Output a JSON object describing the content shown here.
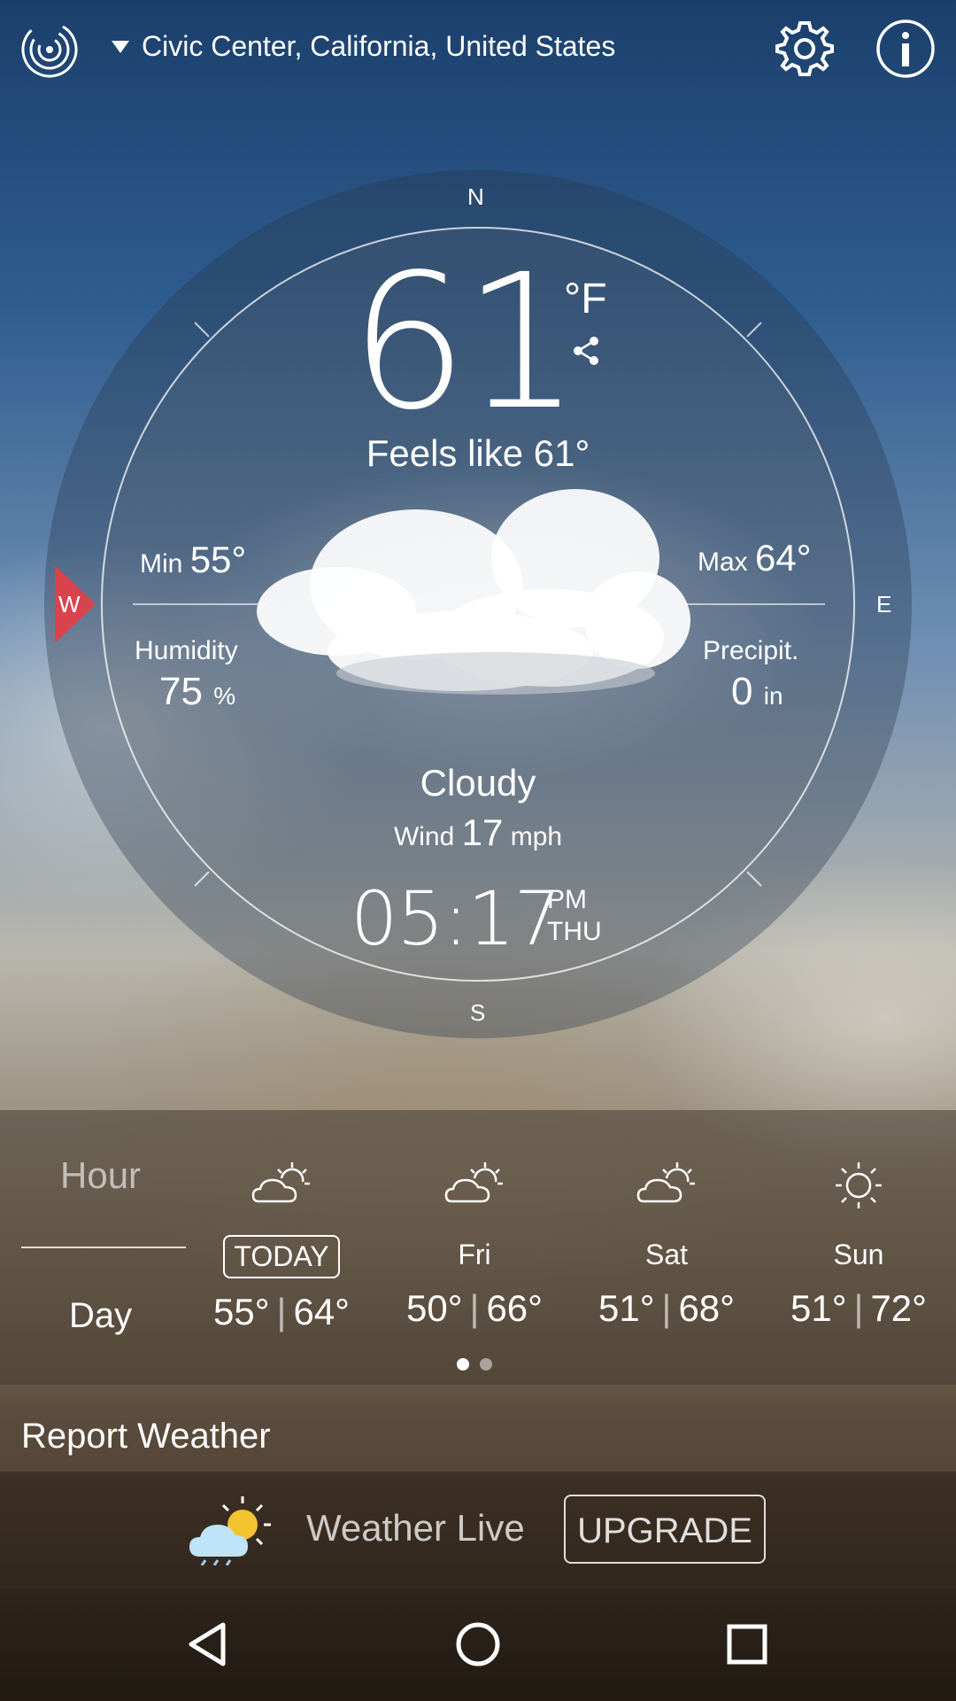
{
  "header": {
    "location": "Civic Center, California, United States",
    "icons": [
      "radar-logo-icon",
      "dropdown-triangle-icon",
      "gear-icon",
      "info-icon"
    ]
  },
  "current": {
    "temperature": "61",
    "unit": "°F",
    "feels_like": "Feels like 61°",
    "min_label": "Min",
    "min_value": "55°",
    "max_label": "Max",
    "max_value": "64°",
    "humidity_label": "Humidity",
    "humidity_value": "75",
    "humidity_unit": "%",
    "precip_label": "Precipit.",
    "precip_value": "0",
    "precip_unit": "in",
    "condition": "Cloudy",
    "wind_label": "Wind",
    "wind_value": "17",
    "wind_unit": "mph",
    "time": "05:17",
    "ampm": "PM",
    "weekday": "THU"
  },
  "compass": {
    "n": "N",
    "s": "S",
    "e": "E",
    "w": "W",
    "wind_direction": "W"
  },
  "forecast": {
    "tab_hour": "Hour",
    "tab_day": "Day",
    "active_tab": "Day",
    "days": [
      {
        "name": "TODAY",
        "low": "55°",
        "high": "64°",
        "icon": "partly-cloudy-icon"
      },
      {
        "name": "Fri",
        "low": "50°",
        "high": "66°",
        "icon": "partly-cloudy-icon"
      },
      {
        "name": "Sat",
        "low": "51°",
        "high": "68°",
        "icon": "partly-cloudy-icon"
      },
      {
        "name": "Sun",
        "low": "51°",
        "high": "72°",
        "icon": "sunny-icon"
      }
    ],
    "page": 1,
    "pages": 2
  },
  "report": {
    "label": "Report Weather"
  },
  "promo": {
    "app_name": "Weather Live",
    "button": "UPGRADE"
  },
  "colors": {
    "wind_marker": "#d9434e",
    "accent": "#ffffff"
  }
}
